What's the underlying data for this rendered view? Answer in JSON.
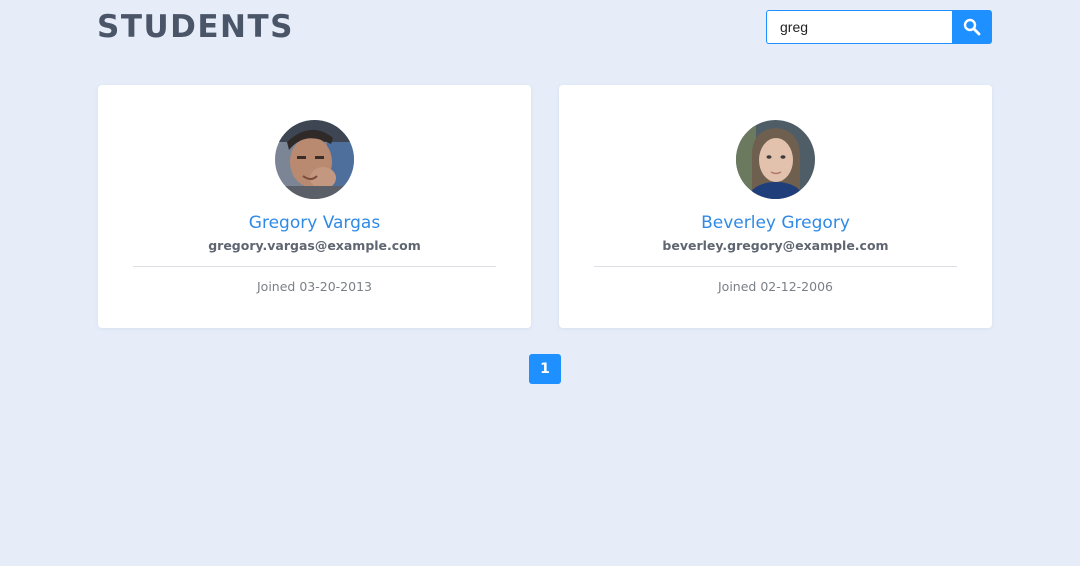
{
  "header": {
    "title": "STUDENTS"
  },
  "search": {
    "value": "greg",
    "button_icon": "search-icon"
  },
  "students": [
    {
      "name": "Gregory Vargas",
      "email": "gregory.vargas@example.com",
      "joined": "Joined 03-20-2013"
    },
    {
      "name": "Beverley Gregory",
      "email": "beverley.gregory@example.com",
      "joined": "Joined 02-12-2006"
    }
  ],
  "pagination": {
    "pages": [
      "1"
    ],
    "current": "1"
  },
  "colors": {
    "background": "#e6edf9",
    "accent": "#1e90ff",
    "name": "#2f8ae6",
    "title": "#4a5568"
  }
}
